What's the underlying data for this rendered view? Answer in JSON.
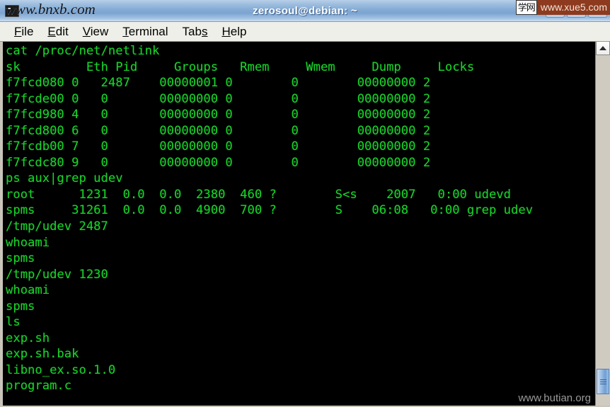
{
  "window": {
    "title": "zerosoul@debian: ~",
    "icon": "terminal-icon",
    "buttons": {
      "minimize": "minimize",
      "maximize": "maximize",
      "close": "close"
    }
  },
  "watermarks": {
    "top_left": "www.bnxb.com",
    "top_right_logo": "学网",
    "top_right": "www.xue5.com",
    "bottom_right": "www.butian.org"
  },
  "menubar": {
    "items": [
      {
        "mnemonic": "F",
        "rest": "ile"
      },
      {
        "mnemonic": "E",
        "rest": "dit"
      },
      {
        "mnemonic": "V",
        "rest": "iew"
      },
      {
        "mnemonic": "T",
        "rest": "erminal"
      },
      {
        "pre": "Tab",
        "mnemonic": "s",
        "rest": ""
      },
      {
        "mnemonic": "H",
        "rest": "elp"
      }
    ]
  },
  "terminal": {
    "foreground": "#18d02a",
    "background": "#000000",
    "lines": [
      "cat /proc/net/netlink",
      "sk         Eth Pid     Groups   Rmem     Wmem     Dump     Locks",
      "f7fcd080 0   2487    00000001 0        0        00000000 2",
      "f7fcde00 0   0       00000000 0        0        00000000 2",
      "f7fcd980 4   0       00000000 0        0        00000000 2",
      "f7fcd800 6   0       00000000 0        0        00000000 2",
      "f7fcdb00 7   0       00000000 0        0        00000000 2",
      "f7fcdc80 9   0       00000000 0        0        00000000 2",
      "ps aux|grep udev",
      "root      1231  0.0  0.0  2380  460 ?        S<s    2007   0:00 udevd",
      "spms     31261  0.0  0.0  4900  700 ?        S    06:08   0:00 grep udev",
      "/tmp/udev 2487",
      "whoami",
      "spms",
      "/tmp/udev 1230",
      "whoami",
      "spms",
      "ls",
      "exp.sh",
      "exp.sh.bak",
      "libno_ex.so.1.0",
      "program.c"
    ]
  },
  "scrollbar": {
    "up_arrow": "scroll-up",
    "position": "bottom"
  }
}
